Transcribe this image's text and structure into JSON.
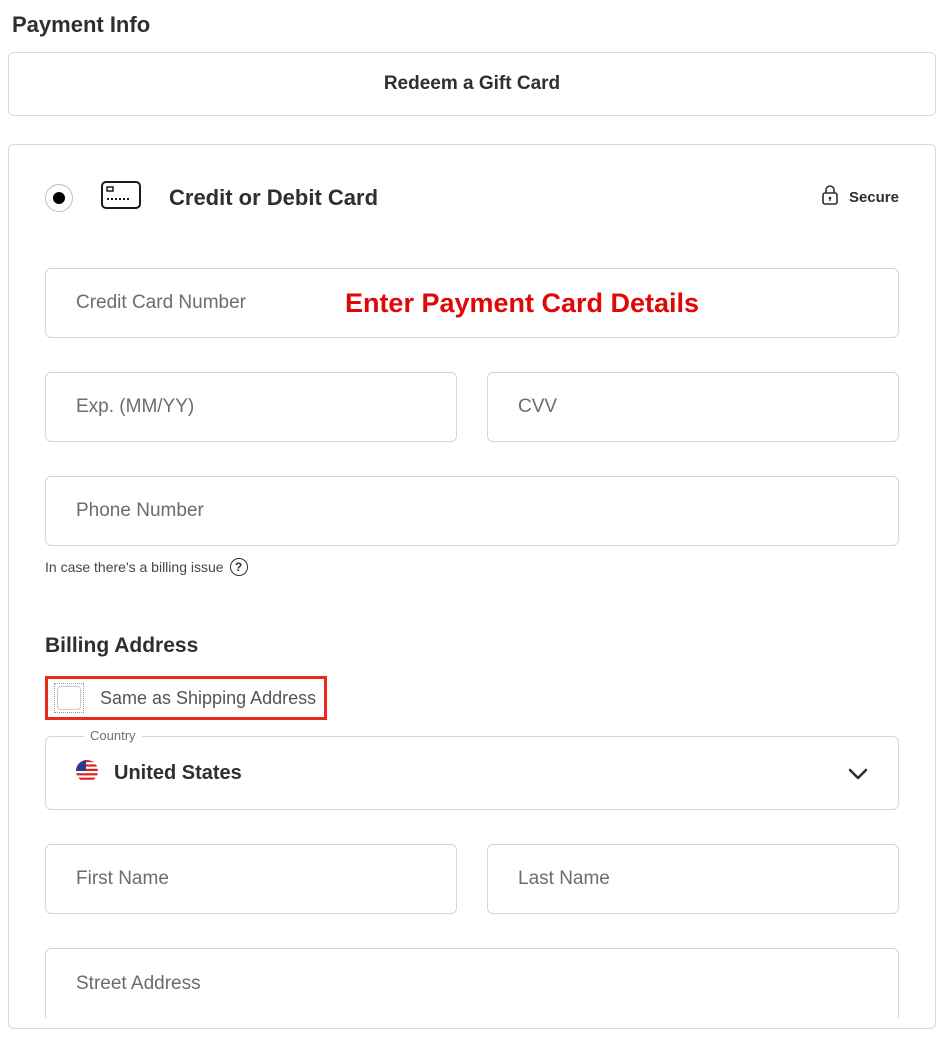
{
  "page_title": "Payment Info",
  "gift_card_label": "Redeem a Gift Card",
  "card_method": {
    "title": "Credit or Debit Card",
    "secure_label": "Secure",
    "cc_placeholder": "Credit Card Number",
    "overlay_text": "Enter Payment Card Details",
    "exp_placeholder": "Exp. (MM/YY)",
    "cvv_placeholder": "CVV",
    "phone_placeholder": "Phone Number",
    "phone_help": "In case there's a billing issue"
  },
  "billing": {
    "title": "Billing Address",
    "same_as_label": "Same as Shipping Address",
    "country_label": "Country",
    "country_value": "United States",
    "first_name_placeholder": "First Name",
    "last_name_placeholder": "Last Name",
    "street_placeholder": "Street Address"
  }
}
